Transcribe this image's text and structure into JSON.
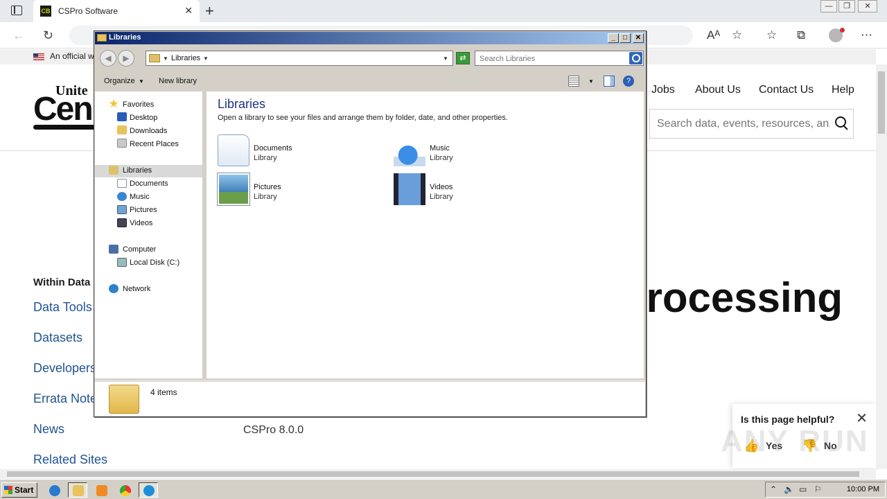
{
  "browser": {
    "tab_title": "CSPro Software",
    "tab_favicon_text": "CB",
    "banner_text": "An official w"
  },
  "site": {
    "logo_top": "Unite",
    "logo_big": "Cen",
    "nav": [
      "Jobs",
      "About Us",
      "Contact Us",
      "Help"
    ],
    "search_placeholder": "Search data, events, resources, an...",
    "within_data": "Within Data",
    "sidenav": [
      "Data Tools",
      "Datasets",
      "Developers",
      "Errata Note",
      "News",
      "Related Sites"
    ],
    "heading": "rocessing",
    "version": "CSPro 8.0.0",
    "helpful": {
      "question": "Is this page helpful?",
      "yes": "Yes",
      "no": "No"
    },
    "watermark": "ANY RUN"
  },
  "explorer": {
    "title": "Libraries",
    "address_crumb": "Libraries",
    "search_placeholder": "Search Libraries",
    "commands": {
      "organize": "Organize",
      "new_library": "New library"
    },
    "nav": {
      "favorites": "Favorites",
      "favorites_items": [
        "Desktop",
        "Downloads",
        "Recent Places"
      ],
      "libraries": "Libraries",
      "libraries_items": [
        "Documents",
        "Music",
        "Pictures",
        "Videos"
      ],
      "computer": "Computer",
      "computer_items": [
        "Local Disk (C:)"
      ],
      "network": "Network"
    },
    "content": {
      "heading": "Libraries",
      "subtitle": "Open a library to see your files and arrange them by folder, date, and other properties.",
      "libraries": [
        {
          "name": "Documents",
          "kind": "Library",
          "icon": "documents-icon"
        },
        {
          "name": "Music",
          "kind": "Library",
          "icon": "music-icon"
        },
        {
          "name": "Pictures",
          "kind": "Library",
          "icon": "pictures-icon"
        },
        {
          "name": "Videos",
          "kind": "Library",
          "icon": "videos-icon"
        }
      ]
    },
    "details": {
      "count": "4 items"
    }
  },
  "taskbar": {
    "start": "Start",
    "clock": "10:00 PM"
  }
}
